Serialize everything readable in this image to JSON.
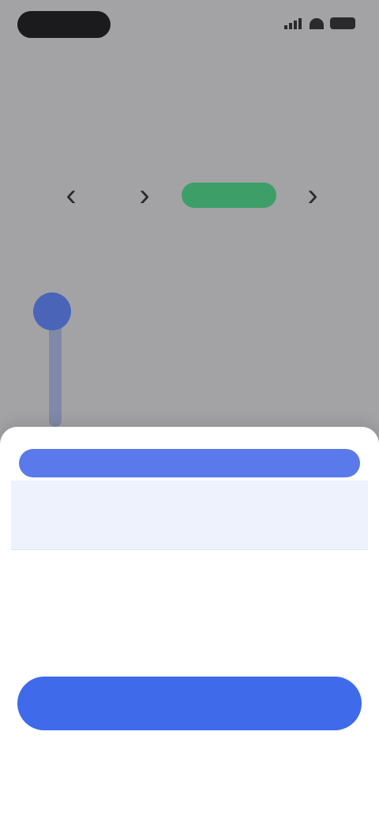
{
  "status_bar": {
    "time": ""
  },
  "background": {
    "title": "",
    "subtitle": "",
    "stepper": {
      "minus": "‹",
      "quantity": "",
      "chip": "",
      "plus": "›"
    },
    "timeline": {
      "heading": "",
      "step1_title": "",
      "step1_desc": "",
      "step2_title": "",
      "step2_desc": ""
    }
  },
  "sheet": {
    "header": "",
    "options": [
      {
        "name": "",
        "description": "",
        "price": "",
        "selected": true
      },
      {
        "name": "",
        "description": "",
        "price": "",
        "selected": false
      }
    ],
    "terms": "",
    "cta_label": "",
    "secondary_link": ""
  },
  "colors": {
    "accent": "#3f6ae9",
    "success": "#3d9f67",
    "overlay": "#a3a3a6"
  }
}
